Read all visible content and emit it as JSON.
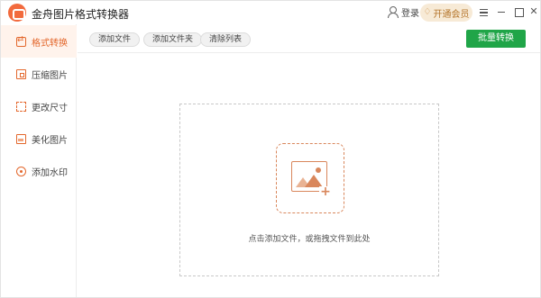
{
  "app": {
    "title": "金舟图片格式转换器"
  },
  "header": {
    "login_label": "登录",
    "vip_label": "开通会员"
  },
  "sidebar": {
    "items": [
      {
        "label": "格式转换",
        "icon": "format-convert-icon",
        "active": true
      },
      {
        "label": "压缩图片",
        "icon": "compress-image-icon",
        "active": false
      },
      {
        "label": "更改尺寸",
        "icon": "resize-icon",
        "active": false
      },
      {
        "label": "美化图片",
        "icon": "beautify-image-icon",
        "active": false
      },
      {
        "label": "添加水印",
        "icon": "watermark-icon",
        "active": false
      }
    ]
  },
  "toolbar": {
    "add_file": "添加文件",
    "add_folder": "添加文件夹",
    "clear_list": "清除列表",
    "batch_convert": "批量转换"
  },
  "dropzone": {
    "hint": "点击添加文件，或拖拽文件到此处"
  },
  "colors": {
    "accent": "#e3672c",
    "primary_button": "#20a548",
    "vip_background": "#f7ead6"
  }
}
